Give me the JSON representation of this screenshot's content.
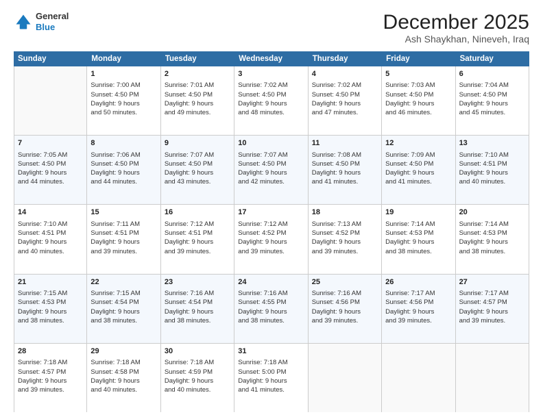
{
  "header": {
    "logo_general": "General",
    "logo_blue": "Blue",
    "title": "December 2025",
    "subtitle": "Ash Shaykhan, Nineveh, Iraq"
  },
  "calendar": {
    "days": [
      "Sunday",
      "Monday",
      "Tuesday",
      "Wednesday",
      "Thursday",
      "Friday",
      "Saturday"
    ],
    "rows": [
      [
        {
          "day": "",
          "info": ""
        },
        {
          "day": "1",
          "info": "Sunrise: 7:00 AM\nSunset: 4:50 PM\nDaylight: 9 hours\nand 50 minutes."
        },
        {
          "day": "2",
          "info": "Sunrise: 7:01 AM\nSunset: 4:50 PM\nDaylight: 9 hours\nand 49 minutes."
        },
        {
          "day": "3",
          "info": "Sunrise: 7:02 AM\nSunset: 4:50 PM\nDaylight: 9 hours\nand 48 minutes."
        },
        {
          "day": "4",
          "info": "Sunrise: 7:02 AM\nSunset: 4:50 PM\nDaylight: 9 hours\nand 47 minutes."
        },
        {
          "day": "5",
          "info": "Sunrise: 7:03 AM\nSunset: 4:50 PM\nDaylight: 9 hours\nand 46 minutes."
        },
        {
          "day": "6",
          "info": "Sunrise: 7:04 AM\nSunset: 4:50 PM\nDaylight: 9 hours\nand 45 minutes."
        }
      ],
      [
        {
          "day": "7",
          "info": "Sunrise: 7:05 AM\nSunset: 4:50 PM\nDaylight: 9 hours\nand 44 minutes."
        },
        {
          "day": "8",
          "info": "Sunrise: 7:06 AM\nSunset: 4:50 PM\nDaylight: 9 hours\nand 44 minutes."
        },
        {
          "day": "9",
          "info": "Sunrise: 7:07 AM\nSunset: 4:50 PM\nDaylight: 9 hours\nand 43 minutes."
        },
        {
          "day": "10",
          "info": "Sunrise: 7:07 AM\nSunset: 4:50 PM\nDaylight: 9 hours\nand 42 minutes."
        },
        {
          "day": "11",
          "info": "Sunrise: 7:08 AM\nSunset: 4:50 PM\nDaylight: 9 hours\nand 41 minutes."
        },
        {
          "day": "12",
          "info": "Sunrise: 7:09 AM\nSunset: 4:50 PM\nDaylight: 9 hours\nand 41 minutes."
        },
        {
          "day": "13",
          "info": "Sunrise: 7:10 AM\nSunset: 4:51 PM\nDaylight: 9 hours\nand 40 minutes."
        }
      ],
      [
        {
          "day": "14",
          "info": "Sunrise: 7:10 AM\nSunset: 4:51 PM\nDaylight: 9 hours\nand 40 minutes."
        },
        {
          "day": "15",
          "info": "Sunrise: 7:11 AM\nSunset: 4:51 PM\nDaylight: 9 hours\nand 39 minutes."
        },
        {
          "day": "16",
          "info": "Sunrise: 7:12 AM\nSunset: 4:51 PM\nDaylight: 9 hours\nand 39 minutes."
        },
        {
          "day": "17",
          "info": "Sunrise: 7:12 AM\nSunset: 4:52 PM\nDaylight: 9 hours\nand 39 minutes."
        },
        {
          "day": "18",
          "info": "Sunrise: 7:13 AM\nSunset: 4:52 PM\nDaylight: 9 hours\nand 39 minutes."
        },
        {
          "day": "19",
          "info": "Sunrise: 7:14 AM\nSunset: 4:53 PM\nDaylight: 9 hours\nand 38 minutes."
        },
        {
          "day": "20",
          "info": "Sunrise: 7:14 AM\nSunset: 4:53 PM\nDaylight: 9 hours\nand 38 minutes."
        }
      ],
      [
        {
          "day": "21",
          "info": "Sunrise: 7:15 AM\nSunset: 4:53 PM\nDaylight: 9 hours\nand 38 minutes."
        },
        {
          "day": "22",
          "info": "Sunrise: 7:15 AM\nSunset: 4:54 PM\nDaylight: 9 hours\nand 38 minutes."
        },
        {
          "day": "23",
          "info": "Sunrise: 7:16 AM\nSunset: 4:54 PM\nDaylight: 9 hours\nand 38 minutes."
        },
        {
          "day": "24",
          "info": "Sunrise: 7:16 AM\nSunset: 4:55 PM\nDaylight: 9 hours\nand 38 minutes."
        },
        {
          "day": "25",
          "info": "Sunrise: 7:16 AM\nSunset: 4:56 PM\nDaylight: 9 hours\nand 39 minutes."
        },
        {
          "day": "26",
          "info": "Sunrise: 7:17 AM\nSunset: 4:56 PM\nDaylight: 9 hours\nand 39 minutes."
        },
        {
          "day": "27",
          "info": "Sunrise: 7:17 AM\nSunset: 4:57 PM\nDaylight: 9 hours\nand 39 minutes."
        }
      ],
      [
        {
          "day": "28",
          "info": "Sunrise: 7:18 AM\nSunset: 4:57 PM\nDaylight: 9 hours\nand 39 minutes."
        },
        {
          "day": "29",
          "info": "Sunrise: 7:18 AM\nSunset: 4:58 PM\nDaylight: 9 hours\nand 40 minutes."
        },
        {
          "day": "30",
          "info": "Sunrise: 7:18 AM\nSunset: 4:59 PM\nDaylight: 9 hours\nand 40 minutes."
        },
        {
          "day": "31",
          "info": "Sunrise: 7:18 AM\nSunset: 5:00 PM\nDaylight: 9 hours\nand 41 minutes."
        },
        {
          "day": "",
          "info": ""
        },
        {
          "day": "",
          "info": ""
        },
        {
          "day": "",
          "info": ""
        }
      ]
    ]
  }
}
